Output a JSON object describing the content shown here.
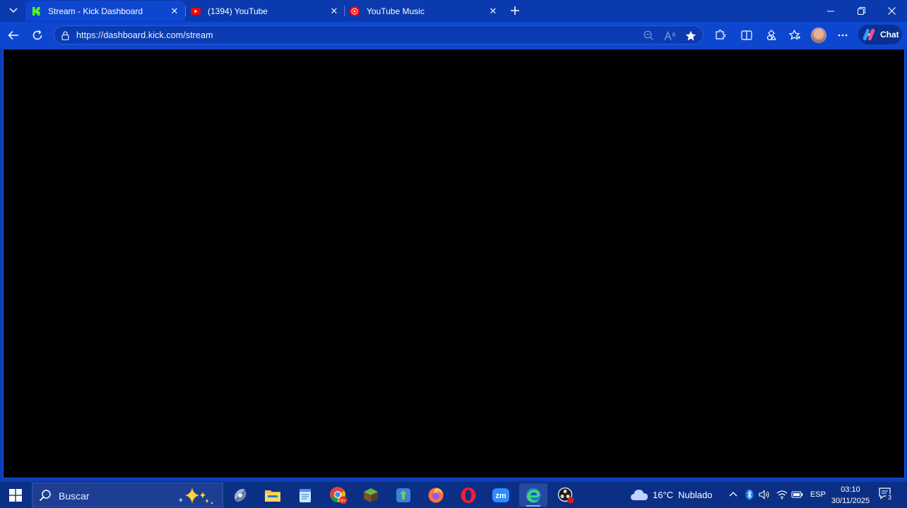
{
  "browser": {
    "tabs": [
      {
        "title": "Stream - Kick Dashboard",
        "favicon": "kick-icon",
        "active": true
      },
      {
        "title": "(1394) YouTube",
        "favicon": "youtube-icon",
        "active": false
      },
      {
        "title": "YouTube Music",
        "favicon": "youtube-music-icon",
        "active": false
      }
    ],
    "url": "https://dashboard.kick.com/stream",
    "chat_label": "Chat",
    "toolbar_icons": [
      "back-arrow-icon",
      "refresh-icon",
      "zoom-out-icon",
      "read-aloud-icon",
      "favorite-star-icon",
      "extensions-icon",
      "split-screen-icon",
      "browser-essentials-icon",
      "favorites-icon",
      "profile-avatar",
      "more-options-icon",
      "copilot-icon"
    ]
  },
  "taskbar": {
    "search_placeholder": "Buscar",
    "weather_temp": "16°C",
    "weather_desc": "Nublado",
    "language": "ESP",
    "time": "03:10",
    "date": "30/11/2025",
    "notification_count": "3",
    "apps": [
      "windows-start-icon",
      "copilot-app-icon",
      "file-explorer-icon",
      "notepad-icon",
      "chrome-icon",
      "minecraft-icon",
      "app-green-icon",
      "firefox-icon",
      "opera-icon",
      "zoom-icon",
      "edge-icon",
      "obs-icon"
    ],
    "colors": {
      "accent": "#0e47cf",
      "taskbar": "#0c2f86",
      "kick_green": "#53fc18",
      "youtube_red": "#ff0000"
    }
  }
}
